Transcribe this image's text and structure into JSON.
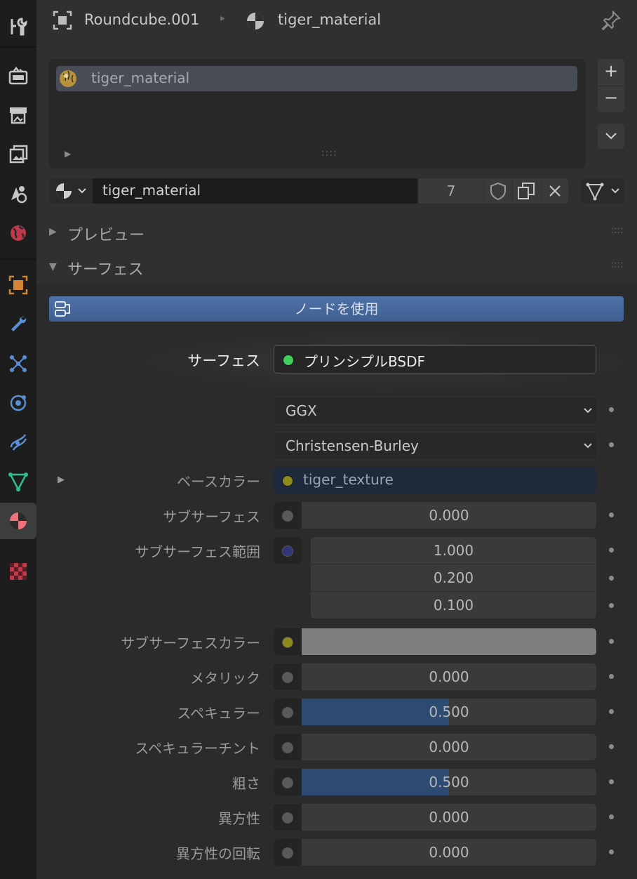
{
  "header": {
    "object_name": "Roundcube.001",
    "material_name": "tiger_material"
  },
  "slot_list": {
    "items": [
      {
        "label": "tiger_material"
      }
    ]
  },
  "datablock": {
    "name": "tiger_material",
    "users": "7"
  },
  "panels": {
    "preview": "プレビュー",
    "surface": "サーフェス"
  },
  "use_nodes_label": "ノードを使用",
  "surface": {
    "label": "サーフェス",
    "shader": "プリンシプルBSDF",
    "distribution": "GGX",
    "subsurface_method": "Christensen-Burley"
  },
  "properties": {
    "base_color": {
      "label": "ベースカラー",
      "value": "tiger_texture"
    },
    "subsurface": {
      "label": "サブサーフェス",
      "value": "0.000"
    },
    "subsurface_radius": {
      "label": "サブサーフェス範囲",
      "values": [
        "1.000",
        "0.200",
        "0.100"
      ]
    },
    "subsurface_color": {
      "label": "サブサーフェスカラー",
      "color": "#7e7e7e"
    },
    "metallic": {
      "label": "メタリック",
      "value": "0.000",
      "fraction": 0
    },
    "specular": {
      "label": "スペキュラー",
      "value": "0.500",
      "fraction": 0.5
    },
    "specular_tint": {
      "label": "スペキュラーチント",
      "value": "0.000",
      "fraction": 0
    },
    "roughness": {
      "label": "粗さ",
      "value": "0.500",
      "fraction": 0.5
    },
    "anisotropic": {
      "label": "異方性",
      "value": "0.000",
      "fraction": 0
    },
    "anisotropic_rotation": {
      "label": "異方性の回転",
      "value": "0.000",
      "fraction": 0
    }
  },
  "colors": {
    "accent_blue": "#2d4a73",
    "shader_socket": "#3fcf5a",
    "color_socket": "#c7c729",
    "vector_socket": "#6363c7",
    "float_socket": "#a1a1a1"
  },
  "icons": {
    "tabs": [
      "tool-icon",
      "render-icon",
      "output-icon",
      "view-layer-icon",
      "scene-icon",
      "world-icon",
      "object-icon",
      "modifier-icon",
      "particles-icon",
      "physics-icon",
      "constraints-icon",
      "data-icon",
      "material-icon",
      "texture-icon"
    ]
  }
}
